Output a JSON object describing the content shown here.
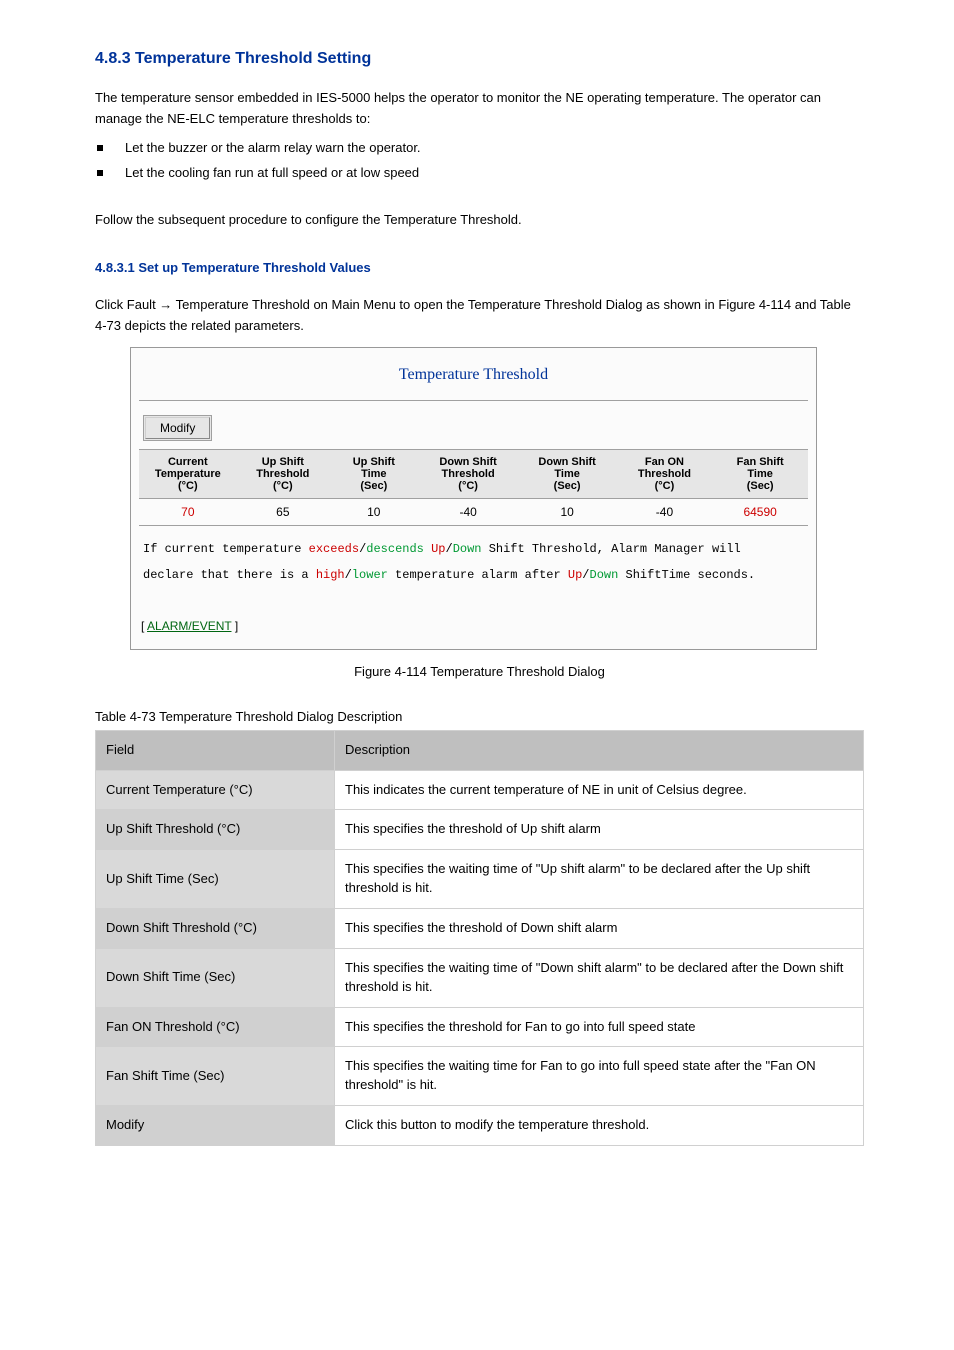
{
  "headings": {
    "section1": "4.8.3 Temperature Threshold Setting",
    "section2": "4.8.3.1 Set up Temperature Threshold Values"
  },
  "intro": {
    "p1": "The temperature sensor embedded in IES-5000 helps the operator to monitor the NE operating temperature. The operator can manage the NE-ELC temperature thresholds to:",
    "b1": "Let the buzzer or the alarm relay warn the operator.",
    "b2": "Let the cooling fan run at full speed or at low speed",
    "p2": "Follow the subsequent procedure to configure the Temperature Threshold.",
    "p3": "Click Fault → Temperature Threshold on Main Menu to open the Temperature Threshold Dialog as shown in Figure 4-114 and Table 4-73 depicts the related parameters."
  },
  "figure": {
    "title": "Temperature Threshold",
    "modify_label": "Modify",
    "cols": {
      "c1a": "Current",
      "c1b": "Temperature",
      "c1c": "(°C)",
      "c2a": "Up Shift",
      "c2b": "Threshold",
      "c2c": "(°C)",
      "c3a": "Up Shift",
      "c3b": "Time",
      "c3c": "(Sec)",
      "c4a": "Down Shift",
      "c4b": "Threshold",
      "c4c": "(°C)",
      "c5a": "Down Shift",
      "c5b": "Time",
      "c5c": "(Sec)",
      "c6a": "Fan ON",
      "c6b": "Threshold",
      "c6c": "(°C)",
      "c7a": "Fan Shift",
      "c7b": "Time",
      "c7c": "(Sec)"
    },
    "row": {
      "v1": "70",
      "v2": "65",
      "v3": "10",
      "v4": "-40",
      "v5": "10",
      "v6": "-40",
      "v7": "64590"
    },
    "notes": {
      "t1": "If current temperature ",
      "t2": "exceeds",
      "t3": "/",
      "t4": "descends",
      "t5": " ",
      "t6": "Up",
      "t7": "/",
      "t8": "Down",
      "t9": "  Shift Threshold, Alarm Manager will",
      "t10": "declare that there is a ",
      "t11": "high",
      "t12": "/",
      "t13": "lower",
      "t14": " temperature alarm after ",
      "t15": "Up",
      "t16": "/",
      "t17": "Down",
      "t18": " ShiftTime seconds."
    },
    "link_open": "[ ",
    "link_text": "ALARM/EVENT",
    "link_close": " ]",
    "caption": "Figure 4-114 Temperature Threshold Dialog"
  },
  "table": {
    "label": "Table 4-73 Temperature Threshold Dialog Description",
    "head_field": "Field",
    "head_desc": "Description",
    "rows": [
      {
        "label": "Current Temperature (°C)",
        "desc": "This indicates the current temperature of NE in unit of Celsius degree."
      },
      {
        "label": "Up Shift Threshold (°C)",
        "desc": "This specifies the threshold of Up shift alarm"
      },
      {
        "label": "Up Shift Time (Sec)",
        "desc": "This specifies the waiting time of \"Up shift alarm\" to be declared after the Up shift threshold is hit."
      },
      {
        "label": "Down Shift Threshold (°C)",
        "desc": "This specifies the threshold of Down shift alarm"
      },
      {
        "label": "Down Shift Time (Sec)",
        "desc": "This specifies the waiting time of \"Down shift alarm\" to be declared after the Down shift threshold is hit."
      },
      {
        "label": "Fan ON Threshold (°C)",
        "desc": "This specifies the threshold for Fan to go into full speed state"
      },
      {
        "label": "Fan Shift Time (Sec)",
        "desc": "This specifies the waiting time for Fan to go into full speed state after the \"Fan ON threshold\" is hit."
      },
      {
        "label": "Modify",
        "desc": "Click this button to modify the temperature threshold."
      }
    ]
  },
  "chart_data": {
    "type": "table",
    "title": "Temperature Threshold",
    "columns": [
      "Current Temperature (°C)",
      "Up Shift Threshold (°C)",
      "Up Shift Time (Sec)",
      "Down Shift Threshold (°C)",
      "Down Shift Time (Sec)",
      "Fan ON Threshold (°C)",
      "Fan Shift Time (Sec)"
    ],
    "values": [
      70,
      65,
      10,
      -40,
      10,
      -40,
      64590
    ]
  }
}
